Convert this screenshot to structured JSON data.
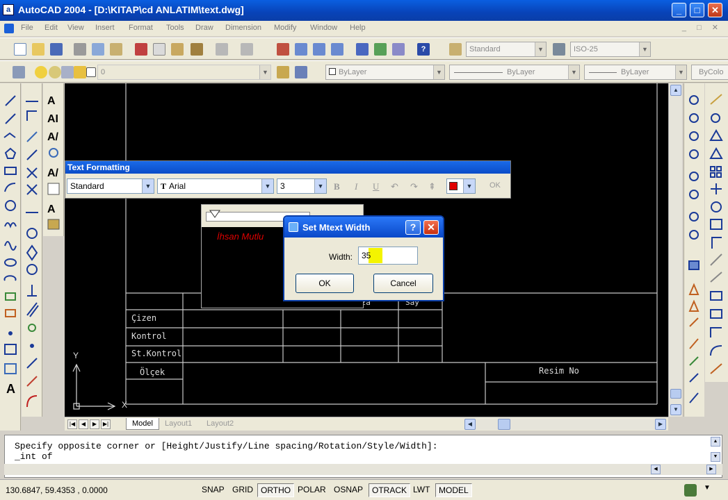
{
  "window": {
    "title": "AutoCAD 2004 - [D:\\KITAP\\cd ANLATIM\\text.dwg]",
    "min": "_",
    "max": "□",
    "close": "✕"
  },
  "menu": [
    "File",
    "Edit",
    "View",
    "Insert",
    "Format",
    "Tools",
    "Draw",
    "Dimension",
    "Modify",
    "Window",
    "Help"
  ],
  "toolbars": {
    "text_style": "Standard",
    "dim_style": "ISO-25",
    "layer": "0",
    "color": "ByLayer",
    "linetype": "ByLayer",
    "lineweight": "ByLayer",
    "plotstyle": "ByColo"
  },
  "title_block": {
    "rows": [
      "Çizen",
      "Kontrol",
      "St.Kontrol",
      "Ölçek"
    ],
    "right_label": "Resim No",
    "partial_header": [
      "yza",
      "Say"
    ]
  },
  "ucs": {
    "x": "X",
    "y": "Y"
  },
  "layout_tabs": [
    "Model",
    "Layout1",
    "Layout2"
  ],
  "text_formatting": {
    "title": "Text Formatting",
    "style": "Standard",
    "font": "Arial",
    "height": "3",
    "bold": "B",
    "italic": "I",
    "underline": "U",
    "ok": "OK",
    "color": "#e00000"
  },
  "mtext_sample": "İhsan Mutlu",
  "dialog": {
    "title": "Set Mtext Width",
    "help": "?",
    "close": "✕",
    "width_label": "Width:",
    "width_value": "35",
    "ok": "OK",
    "cancel": "Cancel"
  },
  "command_line": {
    "line1": "Specify opposite corner or [Height/Justify/Line spacing/Rotation/Style/Width]:",
    "line2": "_int of"
  },
  "status": {
    "coords": "130.6847, 59.4353 , 0.0000",
    "buttons": [
      {
        "label": "SNAP",
        "down": false
      },
      {
        "label": "GRID",
        "down": false
      },
      {
        "label": "ORTHO",
        "down": true
      },
      {
        "label": "POLAR",
        "down": false
      },
      {
        "label": "OSNAP",
        "down": false
      },
      {
        "label": "OTRACK",
        "down": true
      },
      {
        "label": "LWT",
        "down": false
      },
      {
        "label": "MODEL",
        "down": true
      }
    ]
  }
}
